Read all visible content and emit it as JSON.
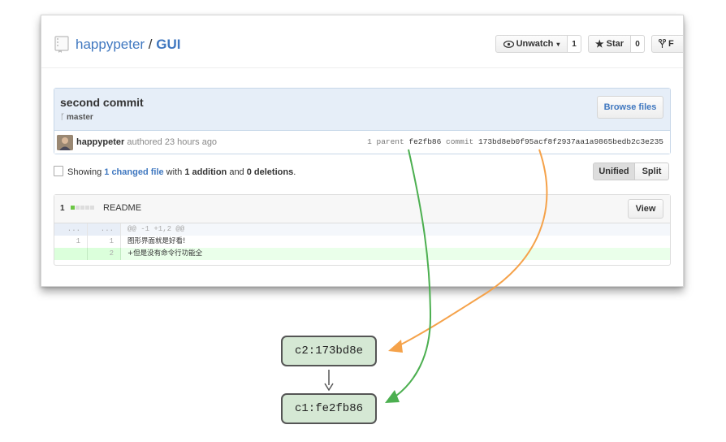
{
  "repo": {
    "owner": "happypeter",
    "separator": " / ",
    "name": "GUI"
  },
  "actions": {
    "unwatch_label": "Unwatch",
    "unwatch_count": "1",
    "star_label": "Star",
    "star_count": "0",
    "fork_label": "F"
  },
  "commit": {
    "title": "second commit",
    "branch": "master",
    "browse_label": "Browse files",
    "author": "happypeter",
    "authored_text": " authored 23 hours ago",
    "parent_prefix": "1 parent ",
    "parent_sha": "fe2fb86",
    "commit_prefix": "commit ",
    "commit_sha": "173bd8eb0f95acf8f2937aa1a9865bedb2c3e235"
  },
  "summary": {
    "showing": "Showing ",
    "changed": "1 changed file",
    "with": " with ",
    "additions": "1 addition",
    "and": " and ",
    "deletions": "0 deletions",
    "end": "."
  },
  "view_toggle": {
    "unified": "Unified",
    "split": "Split"
  },
  "file": {
    "stat_count": "1",
    "name": "README",
    "view_label": "View",
    "hunk": {
      "left": "...",
      "right": "...",
      "text": "@@ -1 +1,2 @@"
    },
    "context_line": {
      "left": "1",
      "right": "1",
      "text": " 图形界面就是好看!"
    },
    "added_line": {
      "left": "",
      "right": "2",
      "text": "+但是没有命令行功能全"
    }
  },
  "graph": {
    "node_c2": "c2:173bd8e",
    "node_c1": "c1:fe2fb86"
  },
  "colors": {
    "link": "#4078c0",
    "node_fill": "#d5e8d4",
    "arrow_green": "#4caf50",
    "arrow_orange": "#f5a24a"
  }
}
